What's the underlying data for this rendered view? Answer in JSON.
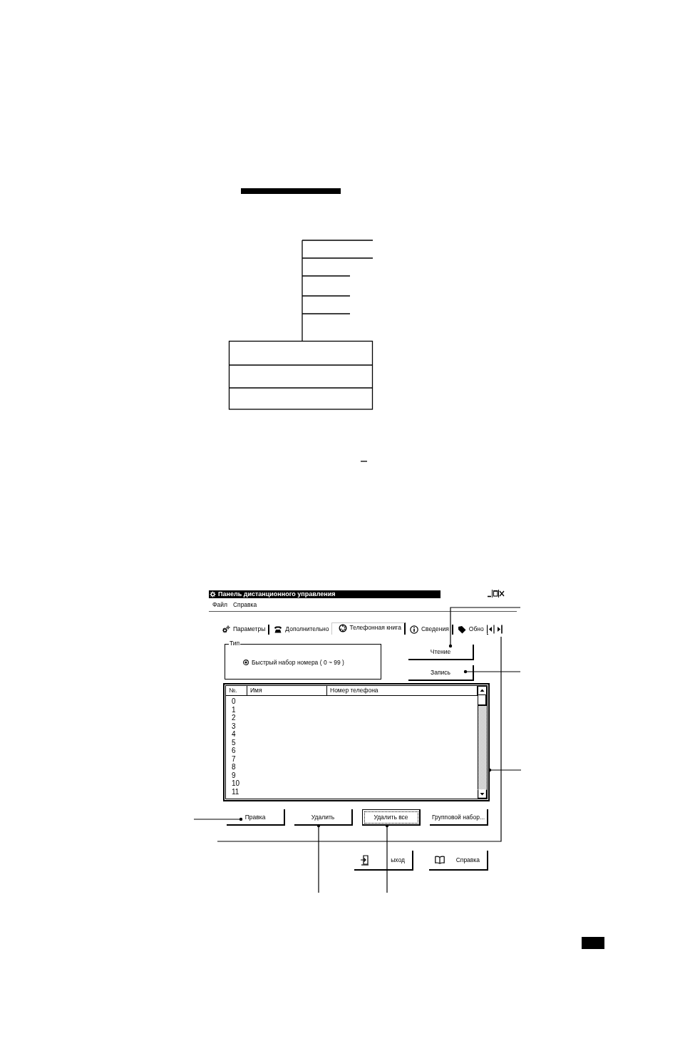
{
  "window": {
    "title": "Панель дистанционного управления"
  },
  "menu": [
    "Файл",
    "Справка"
  ],
  "tabs": [
    {
      "label": "Параметры",
      "selected": false
    },
    {
      "label": "Дополнительно",
      "selected": false
    },
    {
      "label": "Телефонная книга",
      "selected": true
    },
    {
      "label": "Сведения",
      "selected": false
    },
    {
      "label": "Обно",
      "selected": false
    }
  ],
  "type_group": {
    "legend": "Тип",
    "options": [
      {
        "label": "Быстрый набор номера ( 0 ~ 99 )",
        "selected": true
      }
    ]
  },
  "side_buttons": [
    "Чтение",
    "Запись"
  ],
  "list": {
    "columns": [
      "№.",
      "Имя",
      "Номер телефона"
    ],
    "rows": [
      "0",
      "1",
      "2",
      "3",
      "4",
      "5",
      "6",
      "7",
      "8",
      "9",
      "10",
      "11"
    ]
  },
  "list_buttons": [
    {
      "label": "Правка",
      "focused": false
    },
    {
      "label": "Удалить",
      "focused": false
    },
    {
      "label": "Удалить все",
      "focused": true
    },
    {
      "label": "Групповой набор...",
      "focused": false
    }
  ],
  "footer_buttons": [
    "ыход",
    "Справка"
  ]
}
